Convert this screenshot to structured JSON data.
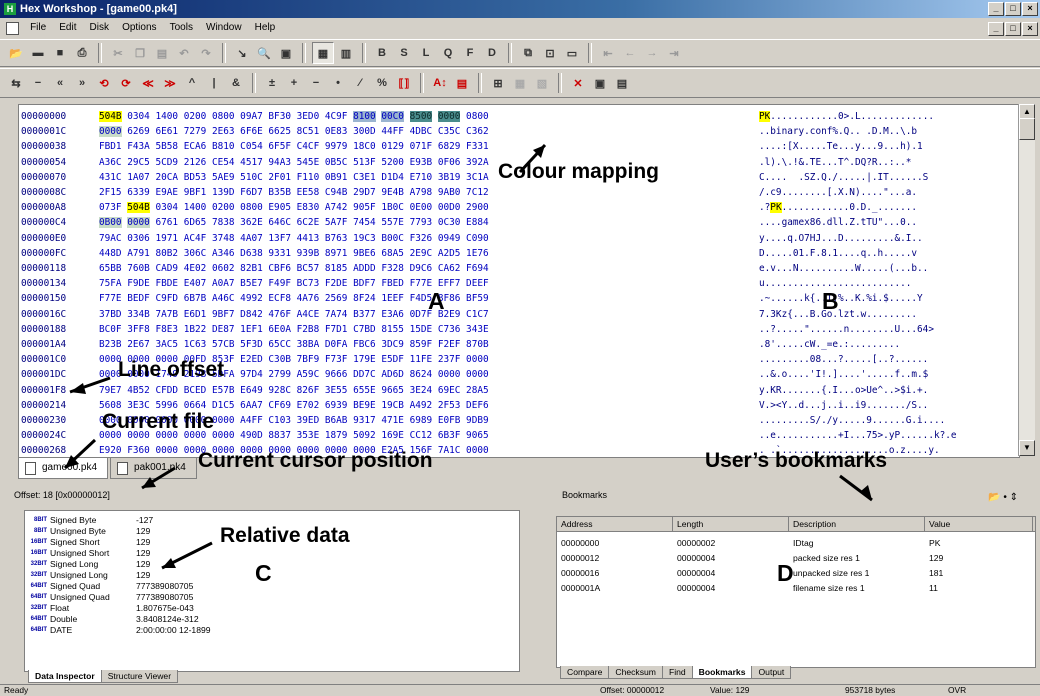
{
  "window": {
    "title": "Hex Workshop - [game00.pk4]"
  },
  "menu": {
    "items": [
      "File",
      "Edit",
      "Disk",
      "Options",
      "Tools",
      "Window",
      "Help"
    ]
  },
  "hex": {
    "offsets": [
      "00000000",
      "0000001C",
      "00000038",
      "00000054",
      "00000070",
      "0000008C",
      "000000A8",
      "000000C4",
      "000000E0",
      "000000FC",
      "00000118",
      "00000134",
      "00000150",
      "0000016C",
      "00000188",
      "000001A4",
      "000001C0",
      "000001DC",
      "000001F8",
      "00000214",
      "00000230",
      "0000024C",
      "00000268"
    ],
    "hex_lines": [
      "504B 0304 1400 0200 0800 09A7 BF30 3ED0 4C9F 8100 00C0 8500 0000 0800",
      "0000 6269 6E61 7279 2E63 6F6E 6625 8C51 0E83 300D 44FF 4DBC C35C C362",
      "FBD1 F43A 5B58 ECA6 B810 C054 6F5F C4CF 9979 18C0 0129 071F 6829 F331",
      "A36C 29C5 5CD9 2126 CE54 4517 94A3 545E 0B5C 513F 5200 E93B 0F06 392A",
      "431C 1A07 20CA BD53 5AE9 510C 2F01 F110 0B91 C3E1 D1D4 E710 3B19 3C1A",
      "2F15 6339 E9AE 9BF1 139D F6D7 B35B EE58 C94B 29D7 9E4B A798 9AB0 7C12",
      "073F 504B 0304 1400 0200 0800 E905 E830 A742 905F 1B0C 0E00 00D0 2900",
      "0B00 0000 6761 6D65 7838 362E 646C 6C2E 5A7F 7454 557E 7793 0C30 E884",
      "79AC 0306 1971 AC4F 3748 4A07 13F7 4413 B763 19C3 B00C F326 0949 C090",
      "448D A791 80B2 306C A346 D638 9331 939B 8971 9BE6 68A5 2E9C A2D5 1E76",
      "65BB 760B CAD9 4E02 0602 82B1 CBF6 BC57 8185 ADDD F328 D9C6 CA62 F694",
      "75FA F9DE FBDE E407 A0A7 B5E7 F49F BC73 F2DE BDF7 FBED F77E EFF7 DEEF",
      "F77E BEDF C9FD 6B7B A46C 4992 ECF8 4A76 2569 8F24 1EEF F4D5 8F86 BF59",
      "37BD 334B 7A7B E6D1 9BF7 D842 476F A4CE 7A74 B377 E3A6 0D7F B2E9 C1C7",
      "BC0F 3FF8 F8E3 1B22 DE87 1EF1 6E0A F2B8 F7D1 C7BD 8155 15DE C736 343E",
      "B23B 2E67 3AC5 1C63 57CB 5F3D 65CC 38BA D0FA FBC6 3DC9 859F F2EF 870B",
      "0000 0000 0000 00FD 853F E2ED C30B 7BF9 F73F 179E E5DF 11FE 237F 0000",
      "0000 0000 1749 219B 5DFA 97D4 2799 A59C 9666 DD7C AD6D 8624 0000 0000",
      "79E7 4B52 CFDD BCED E57B E649 928C 826F 3E55 655E 9665 3E24 69EC 28A5",
      "5608 3E3C 5996 0664 D1C5 6AA7 CF69 E702 6939 BE9E 19CB A492 2F53 DEF6",
      "0000 0000 0000 0000 0000 A4FF C103 39ED B6AB 9317 471E 6989 E0FB 9DB9",
      "0000 0000 0000 0000 0000 490D 8837 353E 1879 5092 169E CC12 6B3F 9065",
      "E920 F360 0000 0000 0000 0000 0000 0000 0000 0000 E2A5 156F 7A1C 0000"
    ],
    "ascii_lines": [
      "PK............0>.L.............",
      "..binary.conf%.Q.. .D.M..\\.b",
      "....:[X.....Te...y...9...h).1",
      ".l).\\.!&.TE...T^.DQ?R..:..*",
      "C....  .SZ.Q./.....|.IT......S",
      "/.c9........[.X.N)....\"...a.",
      ".?PK............0.D._.......",
      "....gamex86.dll.Z.tTU\"...0..",
      "y....q.O7HJ...D.........&.I..",
      "D.....01.F.8.1....q..h.....v",
      "e.v...N..........W.....(...b..",
      "u..........................",
      ".~......k{..I.%..K.%i.$.....Y",
      "7.3Kz{...B.Go.lzt.w.........",
      "..?.....\"......n........U...64>",
      ".8'.....cW._=e.:.........",
      ".........08...?.....[..?......",
      "..&.o....'I!.]....'.....f..m.$",
      "y.KR.......{.I...o>Ue^..>$i.+.",
      "V.><Y..d...j..i..i9......./S..",
      ".........S/./y.....9......G.i....",
      "..e...........+I...75>.yP......k?.e",
      ". .`...................o.z....y."
    ]
  },
  "tabs": {
    "files": [
      "game00.pk4",
      "pak001.pk4"
    ]
  },
  "inspector": {
    "offset_label": "Offset: 18 [0x00000012]",
    "rows": [
      {
        "icon": "8BIT",
        "label": "Signed Byte",
        "value": "-127"
      },
      {
        "icon": "8BIT",
        "label": "Unsigned Byte",
        "value": "129"
      },
      {
        "icon": "16BIT",
        "label": "Signed Short",
        "value": "129"
      },
      {
        "icon": "16BIT",
        "label": "Unsigned Short",
        "value": "129"
      },
      {
        "icon": "32BIT",
        "label": "Signed Long",
        "value": "129"
      },
      {
        "icon": "32BIT",
        "label": "Unsigned Long",
        "value": "129"
      },
      {
        "icon": "64BIT",
        "label": "Signed Quad",
        "value": "777389080705"
      },
      {
        "icon": "64BIT",
        "label": "Unsigned Quad",
        "value": "777389080705"
      },
      {
        "icon": "32BIT",
        "label": "Float",
        "value": "1.807675e-043"
      },
      {
        "icon": "64BIT",
        "label": "Double",
        "value": "3.8408124e-312"
      },
      {
        "icon": "64BIT",
        "label": "DATE",
        "value": "2:00:00:00 12-1899"
      }
    ],
    "tabs": [
      "Data Inspector",
      "Structure Viewer"
    ]
  },
  "bookmarks": {
    "title": "Bookmarks",
    "columns": [
      "Address",
      "Length",
      "Description",
      "Value"
    ],
    "rows": [
      {
        "address": "00000000",
        "length": "00000002",
        "description": "IDtag",
        "value": "PK"
      },
      {
        "address": "00000012",
        "length": "00000004",
        "description": "packed size res 1",
        "value": "129"
      },
      {
        "address": "00000016",
        "length": "00000004",
        "description": "unpacked size res 1",
        "value": "181"
      },
      {
        "address": "0000001A",
        "length": "00000004",
        "description": "filename size res 1",
        "value": "11"
      }
    ],
    "tabs": [
      "Compare",
      "Checksum",
      "Find",
      "Bookmarks",
      "Output"
    ]
  },
  "status": {
    "ready": "Ready",
    "offset": "Offset: 00000012",
    "value": "Value: 129",
    "size": "953718 bytes",
    "mode": "OVR"
  },
  "annotations": {
    "colour_mapping": "Colour mapping",
    "line_offset": "Line offset",
    "current_file": "Current file",
    "cursor_pos": "Current cursor position",
    "user_bookmarks": "User’s bookmarks",
    "relative_data": "Relative data",
    "A": "A",
    "B": "B",
    "C": "C",
    "D": "D"
  }
}
